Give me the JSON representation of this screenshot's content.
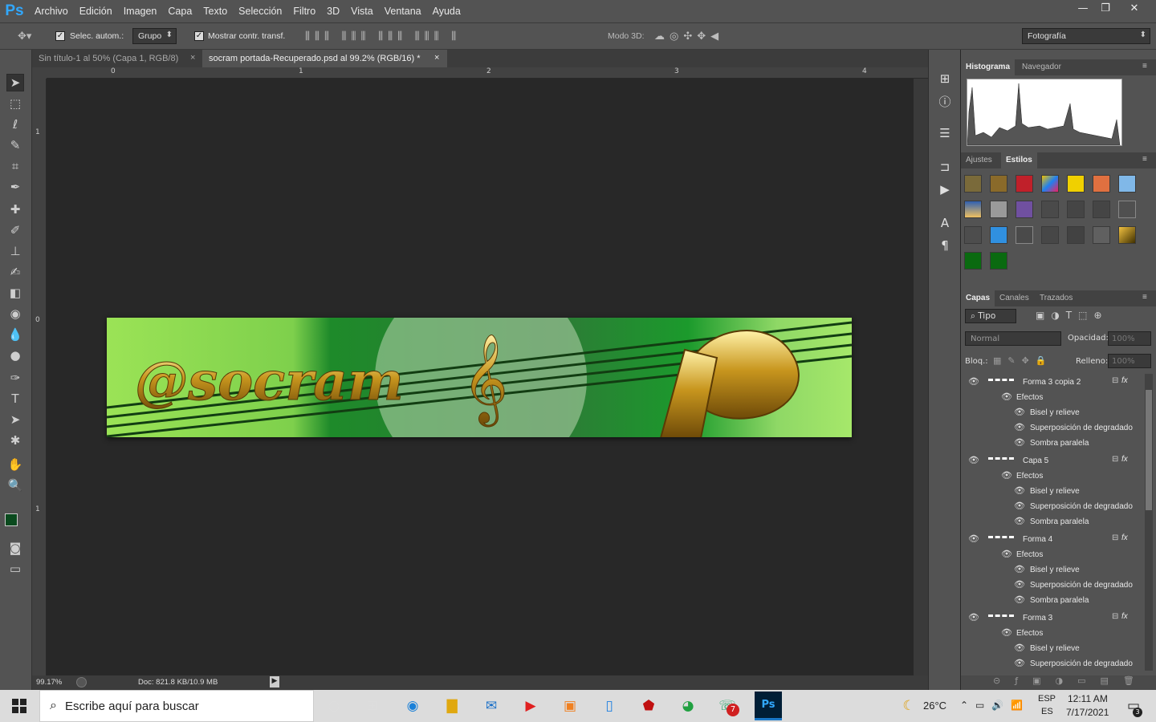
{
  "app": {
    "logo": "Ps"
  },
  "menu": [
    "Archivo",
    "Edición",
    "Imagen",
    "Capa",
    "Texto",
    "Selección",
    "Filtro",
    "3D",
    "Vista",
    "Ventana",
    "Ayuda"
  ],
  "window_controls": {
    "minimize": "—",
    "restore": "❐",
    "close": "✕"
  },
  "options": {
    "auto_select_label": "Selec. autom.:",
    "auto_select_value": "Grupo",
    "show_transform_label": "Mostrar contr. transf.",
    "mode3d_label": "Modo 3D:",
    "workspace": "Fotografía"
  },
  "doc_tabs": [
    {
      "label": "Sin título-1 al 50% (Capa 1, RGB/8)",
      "close": "×"
    },
    {
      "label": "socram portada-Recuperado.psd al 99.2% (RGB/16) *",
      "close": "×"
    }
  ],
  "ruler": {
    "h": [
      "0",
      "1",
      "2",
      "3",
      "4"
    ],
    "v": [
      "1",
      "0",
      "1"
    ]
  },
  "banner": {
    "text": "@socram"
  },
  "status": {
    "zoom": "99.17%",
    "doc": "Doc: 821.8 KB/10.9 MB"
  },
  "panels": {
    "histo_tabs": [
      "Histograma",
      "Navegador"
    ],
    "style_tabs": [
      "Ajustes",
      "Estilos"
    ],
    "layer_tabs": [
      "Capas",
      "Canales",
      "Trazados"
    ],
    "filter_kind": "Tipo",
    "blend_mode": "Normal",
    "opacity_label": "Opacidad:",
    "opacity_value": "100%",
    "lock_label": "Bloq.:",
    "fill_label": "Relleno:",
    "fill_value": "100%"
  },
  "layers": [
    {
      "name": "Forma 3 copia 2",
      "effects_label": "Efectos",
      "effects": [
        "Bisel y relieve",
        "Superposición de degradado",
        "Sombra paralela"
      ]
    },
    {
      "name": "Capa 5",
      "effects_label": "Efectos",
      "effects": [
        "Bisel y relieve",
        "Superposición de degradado",
        "Sombra paralela"
      ]
    },
    {
      "name": "Forma 4",
      "effects_label": "Efectos",
      "effects": [
        "Bisel y relieve",
        "Superposición de degradado",
        "Sombra paralela"
      ]
    },
    {
      "name": "Forma 3",
      "effects_label": "Efectos",
      "effects": [
        "Bisel y relieve",
        "Superposición de degradado"
      ]
    }
  ],
  "fx_label": "fx",
  "taskbar": {
    "search_placeholder": "Escribe aquí para buscar",
    "temp": "26°C",
    "lang": "ESP",
    "lang2": "ES",
    "time": "12:11 AM",
    "date": "7/17/2021",
    "notif": "3",
    "badge": "7"
  }
}
